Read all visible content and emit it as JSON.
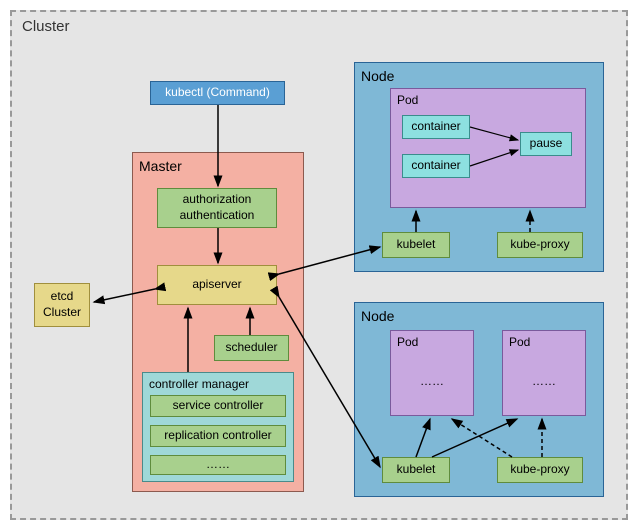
{
  "cluster": {
    "label": "Cluster"
  },
  "cmd": {
    "label": "kubectl (Command)"
  },
  "master": {
    "label": "Master",
    "auth": "authorization\nauthentication",
    "apiserver": "apiserver",
    "scheduler": "scheduler",
    "cm": {
      "label": "controller manager",
      "service": "service controller",
      "replication": "replication controller",
      "more": "……"
    }
  },
  "etcd": "etcd\nCluster",
  "node1": {
    "label": "Node",
    "pod": {
      "label": "Pod",
      "container1": "container",
      "container2": "container",
      "pause": "pause"
    },
    "kubelet": "kubelet",
    "kubeproxy": "kube-proxy"
  },
  "node2": {
    "label": "Node",
    "pod1": {
      "label": "Pod",
      "more": "……"
    },
    "pod2": {
      "label": "Pod",
      "more": "……"
    },
    "kubelet": "kubelet",
    "kubeproxy": "kube-proxy"
  }
}
